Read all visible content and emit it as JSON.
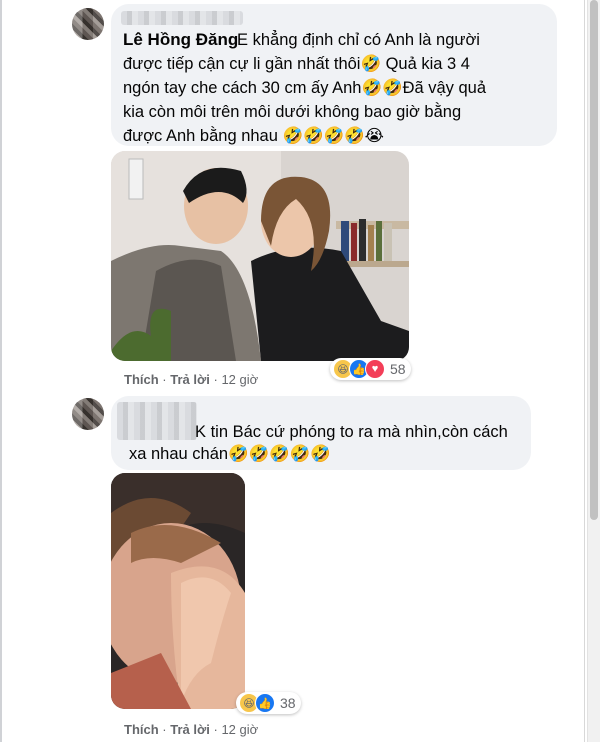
{
  "comments": [
    {
      "author": "Lê Hồng Đăng",
      "text_lines": [
        " E khẳng định chỉ có Anh là người",
        "được tiếp cận cự li gần nhất thôi🤣 Quả kia 3 4",
        "ngón tay che cách 30 cm ấy Anh🤣🤣Đã vậy quả",
        "kia còn môi trên môi dưới không bao giờ bằng",
        "được Anh bằng nhau 🤣🤣🤣🤣😭"
      ],
      "actions": {
        "like": "Thích",
        "reply": "Trả lời",
        "time": "12 giờ"
      },
      "reaction_count": "58",
      "reaction_icons": [
        "haha-icon",
        "like-icon",
        "love-icon"
      ]
    },
    {
      "author": "",
      "text_lines": [
        "K tin Bác cứ phóng to ra mà nhìn,còn cách",
        "xa nhau chán🤣🤣🤣🤣🤣"
      ],
      "actions": {
        "like": "Thích",
        "reply": "Trả lời",
        "time": "12 giờ"
      },
      "reaction_count": "38",
      "reaction_icons": [
        "haha-icon",
        "like-icon"
      ]
    }
  ],
  "separator": "·",
  "colors": {
    "bubble": "#f0f2f5",
    "meta": "#65676b",
    "like_blue": "#1877f2",
    "love_red": "#f33e58",
    "haha_yellow": "#f7c64b"
  }
}
